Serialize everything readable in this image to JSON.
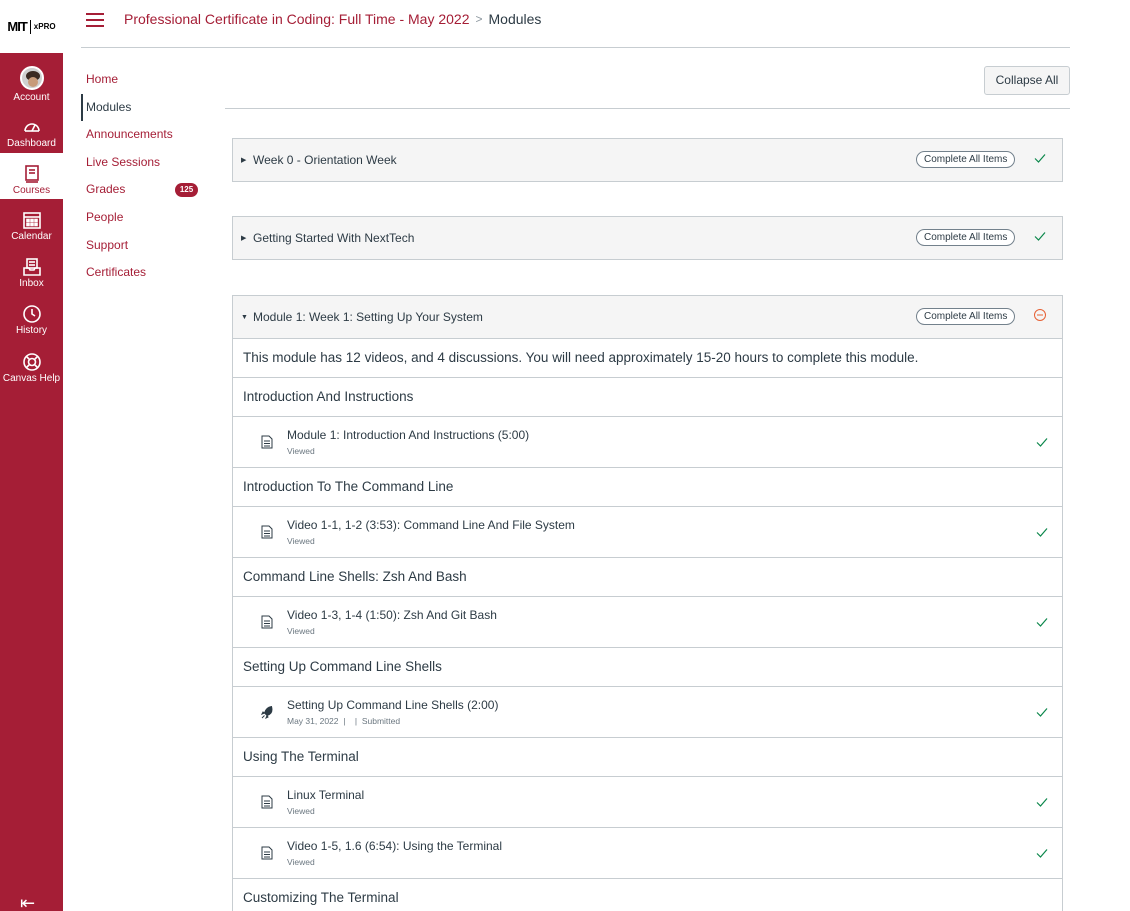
{
  "logo": {
    "mit": "MIT",
    "xpro": "xPRO"
  },
  "global_nav": [
    {
      "label": "Account",
      "icon": "avatar"
    },
    {
      "label": "Dashboard",
      "icon": "dashboard-icon"
    },
    {
      "label": "Courses",
      "icon": "courses-icon"
    },
    {
      "label": "Calendar",
      "icon": "calendar-icon"
    },
    {
      "label": "Inbox",
      "icon": "inbox-icon"
    },
    {
      "label": "History",
      "icon": "history-icon"
    },
    {
      "label": "Canvas Help",
      "icon": "help-icon"
    }
  ],
  "breadcrumb": {
    "course": "Professional Certificate in Coding: Full Time - May 2022",
    "separator": ">",
    "page": "Modules"
  },
  "course_nav": [
    {
      "label": "Home"
    },
    {
      "label": "Modules"
    },
    {
      "label": "Announcements"
    },
    {
      "label": "Live Sessions"
    },
    {
      "label": "Grades",
      "badge": "125"
    },
    {
      "label": "People"
    },
    {
      "label": "Support"
    },
    {
      "label": "Certificates"
    }
  ],
  "toolbar": {
    "collapse_all": "Collapse All"
  },
  "complete_label": "Complete All Items",
  "modules": [
    {
      "title": "Week 0 - Orientation Week",
      "expanded": false
    },
    {
      "title": "Getting Started With NextTech",
      "expanded": false
    },
    {
      "title": "Module 1: Week 1: Setting Up Your System",
      "expanded": true,
      "description": "This module has 12 videos, and 4 discussions. You will need approximately 15-20 hours to complete this module.",
      "sections": [
        {
          "header": "Introduction And Instructions",
          "items": [
            {
              "title": "Module 1: Introduction And Instructions (5:00)",
              "meta": "Viewed",
              "type": "page"
            }
          ]
        },
        {
          "header": "Introduction To The Command Line",
          "items": [
            {
              "title": "Video 1-1, 1-2 (3:53): Command Line And File System",
              "meta": "Viewed",
              "type": "page"
            }
          ]
        },
        {
          "header": "Command Line Shells: Zsh And Bash",
          "items": [
            {
              "title": "Video 1-3, 1-4 (1:50): Zsh And Git Bash",
              "meta": "Viewed",
              "type": "page"
            }
          ]
        },
        {
          "header": "Setting Up Command Line Shells",
          "items": [
            {
              "title": "Setting Up Command Line Shells (2:00)",
              "meta": "May 31, 2022  |    |  Submitted",
              "type": "assignment"
            }
          ]
        },
        {
          "header": "Using The Terminal",
          "items": [
            {
              "title": "Linux Terminal",
              "meta": "Viewed",
              "type": "page"
            },
            {
              "title": "Video 1-5, 1.6 (6:54): Using the Terminal",
              "meta": "Viewed",
              "type": "page"
            }
          ]
        },
        {
          "header": "Customizing The Terminal",
          "items": []
        }
      ]
    }
  ],
  "colors": {
    "brand": "#a51e36",
    "check": "#0b874b",
    "border": "#c7cdd1"
  }
}
